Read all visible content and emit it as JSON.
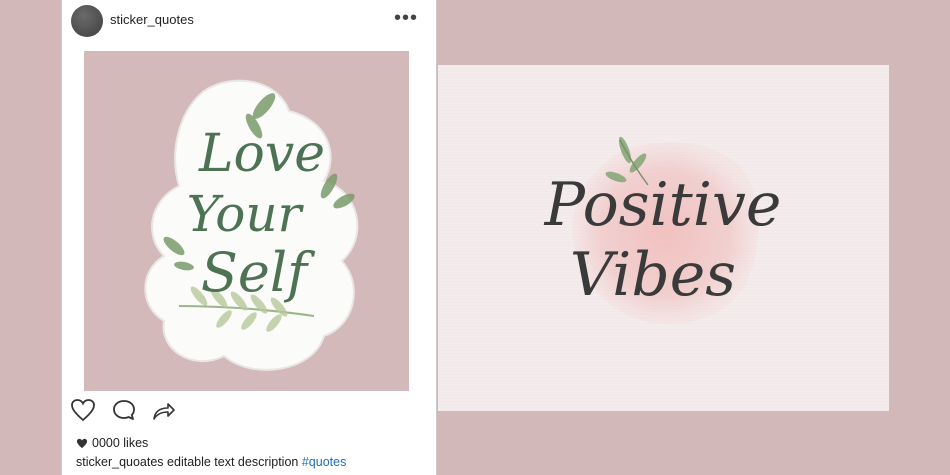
{
  "post": {
    "username": "sticker_quotes",
    "more_label": "•••",
    "likes": "0000 likes",
    "caption_user": "sticker_quoates",
    "caption_text": " editable text description ",
    "hashtag": "#quotes",
    "sticker_text": [
      "Love",
      "Your",
      "Self"
    ]
  },
  "card": {
    "text_line1": "Positive",
    "text_line2": "Vibes"
  },
  "colors": {
    "background": "#d2b8b9",
    "sticker_text": "#4d7354",
    "card_text": "#3a3a3a",
    "hashtag": "#1d6fb8"
  },
  "icons": [
    "heart-icon",
    "comment-icon",
    "share-icon",
    "more-icon",
    "like-heart-icon"
  ]
}
